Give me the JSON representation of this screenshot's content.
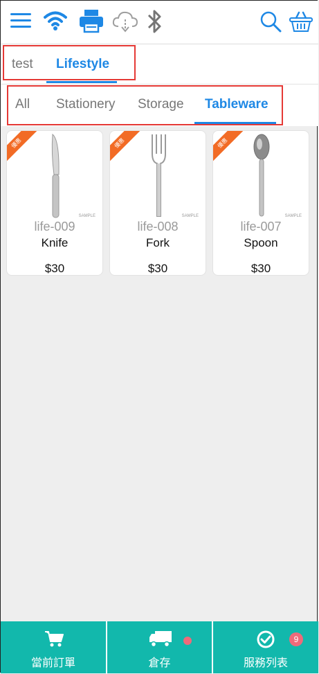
{
  "toolbar": {
    "icons": [
      "menu-icon",
      "wifi-icon",
      "printer-icon",
      "cloud-download-icon",
      "bluetooth-icon",
      "search-icon",
      "basket-icon"
    ]
  },
  "categories": [
    {
      "label": "test",
      "active": false
    },
    {
      "label": "Lifestyle",
      "active": true
    }
  ],
  "subcategories": [
    {
      "label": "All",
      "active": false
    },
    {
      "label": "Stationery",
      "active": false
    },
    {
      "label": "Storage",
      "active": false
    },
    {
      "label": "Tableware",
      "active": true
    }
  ],
  "products": [
    {
      "code": "life-009",
      "name": "Knife",
      "price": "$30",
      "ribbon": "優惠",
      "sample": "SAMPLE",
      "icon": "knife-icon"
    },
    {
      "code": "life-008",
      "name": "Fork",
      "price": "$30",
      "ribbon": "優惠",
      "sample": "SAMPLE",
      "icon": "fork-icon"
    },
    {
      "code": "life-007",
      "name": "Spoon",
      "price": "$30",
      "ribbon": "優惠",
      "sample": "SAMPLE",
      "icon": "spoon-icon"
    }
  ],
  "bottom_nav": [
    {
      "label": "當前訂單",
      "icon": "cart-icon"
    },
    {
      "label": "倉存",
      "icon": "truck-icon"
    },
    {
      "label": "服務列表",
      "icon": "check-circle-icon",
      "badge": "9"
    }
  ],
  "colors": {
    "accent": "#1e88e5",
    "bottom_bar": "#12b8ac",
    "ribbon": "#f26b25",
    "highlight": "#e53935",
    "badge": "#ef6a7a"
  }
}
